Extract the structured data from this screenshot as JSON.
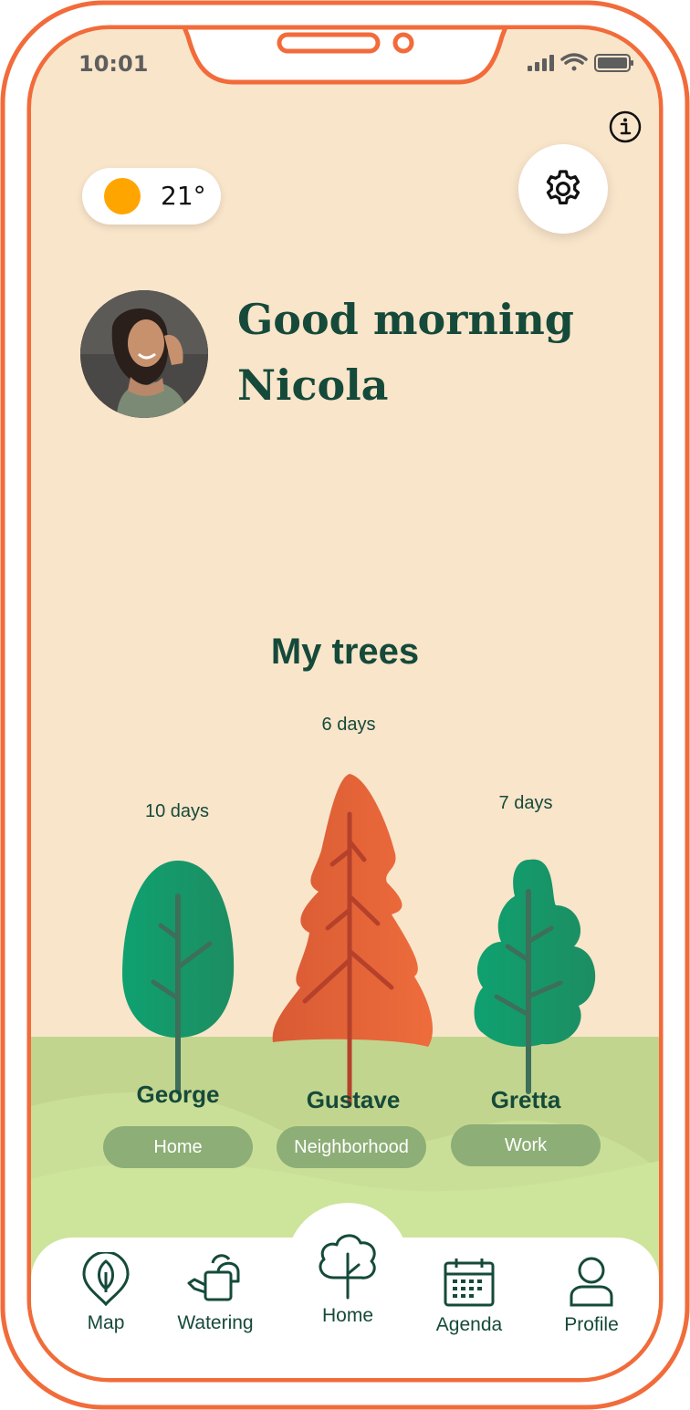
{
  "status_bar": {
    "time": "10:01"
  },
  "weather": {
    "temperature": "21°",
    "sun_color": "#ffa500"
  },
  "greeting": {
    "line1": "Good morning",
    "line2": "Nicola"
  },
  "section": {
    "title": "My trees"
  },
  "trees": [
    {
      "name": "George",
      "location": "Home",
      "days": "10 days",
      "color": "#15a06f"
    },
    {
      "name": "Gustave",
      "location": "Neighborhood",
      "days": "6 days",
      "color": "#e4683b"
    },
    {
      "name": "Gretta",
      "location": "Work",
      "days": "7 days",
      "color": "#15a06f"
    }
  ],
  "nav": {
    "items": [
      {
        "label": "Map",
        "icon": "map-pin-leaf-icon"
      },
      {
        "label": "Watering",
        "icon": "watering-can-icon"
      },
      {
        "label": "Home",
        "icon": "tree-home-icon"
      },
      {
        "label": "Agenda",
        "icon": "calendar-icon"
      },
      {
        "label": "Profile",
        "icon": "user-icon"
      }
    ]
  },
  "colors": {
    "frame": "#f26b3a",
    "background": "#f9e5ca",
    "text_dark_green": "#154a3a",
    "grass_light": "#cde49b",
    "grass_mid": "#c2d58f",
    "tag": "#8dae76"
  }
}
